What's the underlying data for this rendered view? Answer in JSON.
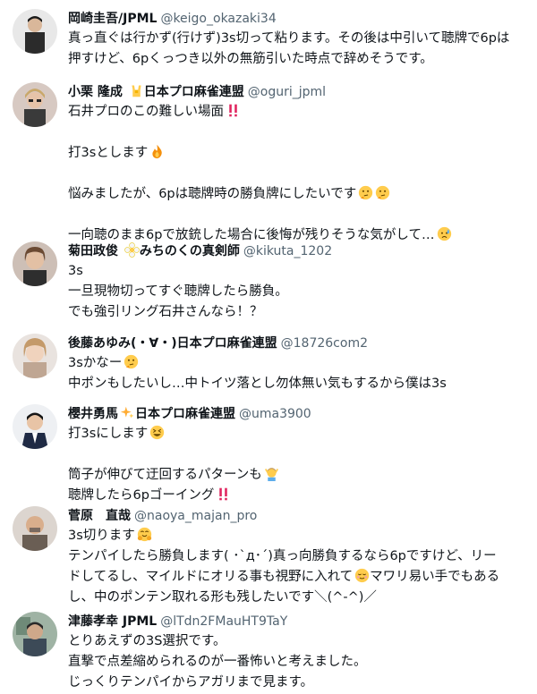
{
  "tweets": [
    {
      "name": "岡崎圭吾/JPML",
      "handle": "@keigo_okazaki34",
      "lines": [
        "真っ直ぐは行かず(行けず)3s切って粘ります。その後は中引いて聴牌で6pは",
        "押すけど、6pくっつき以外の無筋引いた時点で辞めそうです。"
      ]
    },
    {
      "name": "小栗 隆成",
      "name_suffix": "日本プロ麻雀連盟",
      "handle": "@oguri_jpml",
      "lines": [
        "石井プロのこの難しい場面",
        "",
        "打3sとします",
        "",
        "悩みましたが、6pは聴牌時の勝負牌にしたいです",
        "",
        "一向聴のまま6pで放銃した場合に後悔が残りそうな気がして…"
      ]
    },
    {
      "name": "菊田政俊",
      "name_suffix": "みちのくの真剣師",
      "handle": "@kikuta_1202",
      "lines": [
        "3s",
        "一旦現物切ってすぐ聴牌したら勝負。",
        "でも強引リング石井さんなら！？"
      ]
    },
    {
      "name": "後藤あゆみ(・∀・)日本プロ麻雀連盟",
      "handle": "@18726com2",
      "lines": [
        "3sかなー",
        "中ポンもしたいし…中トイツ落とし勿体無い気もするから僕は3s"
      ]
    },
    {
      "name": "櫻井勇馬",
      "name_suffix": "日本プロ麻雀連盟",
      "handle": "@uma3900",
      "lines": [
        "打3sにします",
        "",
        "筒子が伸びて迂回するパターンも",
        "聴牌したら6pゴーイング"
      ]
    },
    {
      "name": "菅原　直哉",
      "handle": "@naoya_majan_pro",
      "lines": [
        "3s切ります",
        "テンパイしたら勝負します( ･`д･´)真っ向勝負するなら6pですけど、リー",
        "ドしてるし、マイルドにオリる事も視野に入れて",
        "し、中のポンテン取れる形も残したいです＼(^-^)／"
      ],
      "line3_tail": "マワリ易い手でもある"
    },
    {
      "name": "津藤孝幸 JPML",
      "handle": "@lTdn2FMauHT9TaY",
      "lines": [
        "とりあえずの3S選択です。",
        "直撃で点差縮められるのが一番怖いと考えました。",
        "じっくりテンパイからアガリまで見ます。"
      ]
    }
  ],
  "colors": {
    "text": "#0f1419",
    "handle": "#536471",
    "double_exclaim": "#e0245e"
  },
  "icons": {
    "t1": "double-exclamation-icon",
    "t2": "fire-icon",
    "t3": "thinking-face-icon",
    "t4": "anxious-face-icon",
    "t5": "sparkles-icon",
    "t6": "grinning-squint-face-icon",
    "t7": "person-gesturing-icon",
    "t8": "hugging-face-icon",
    "t9": "relieved-face-icon",
    "t10": "sign-of-horns-icon",
    "t11": "flower-icon"
  }
}
